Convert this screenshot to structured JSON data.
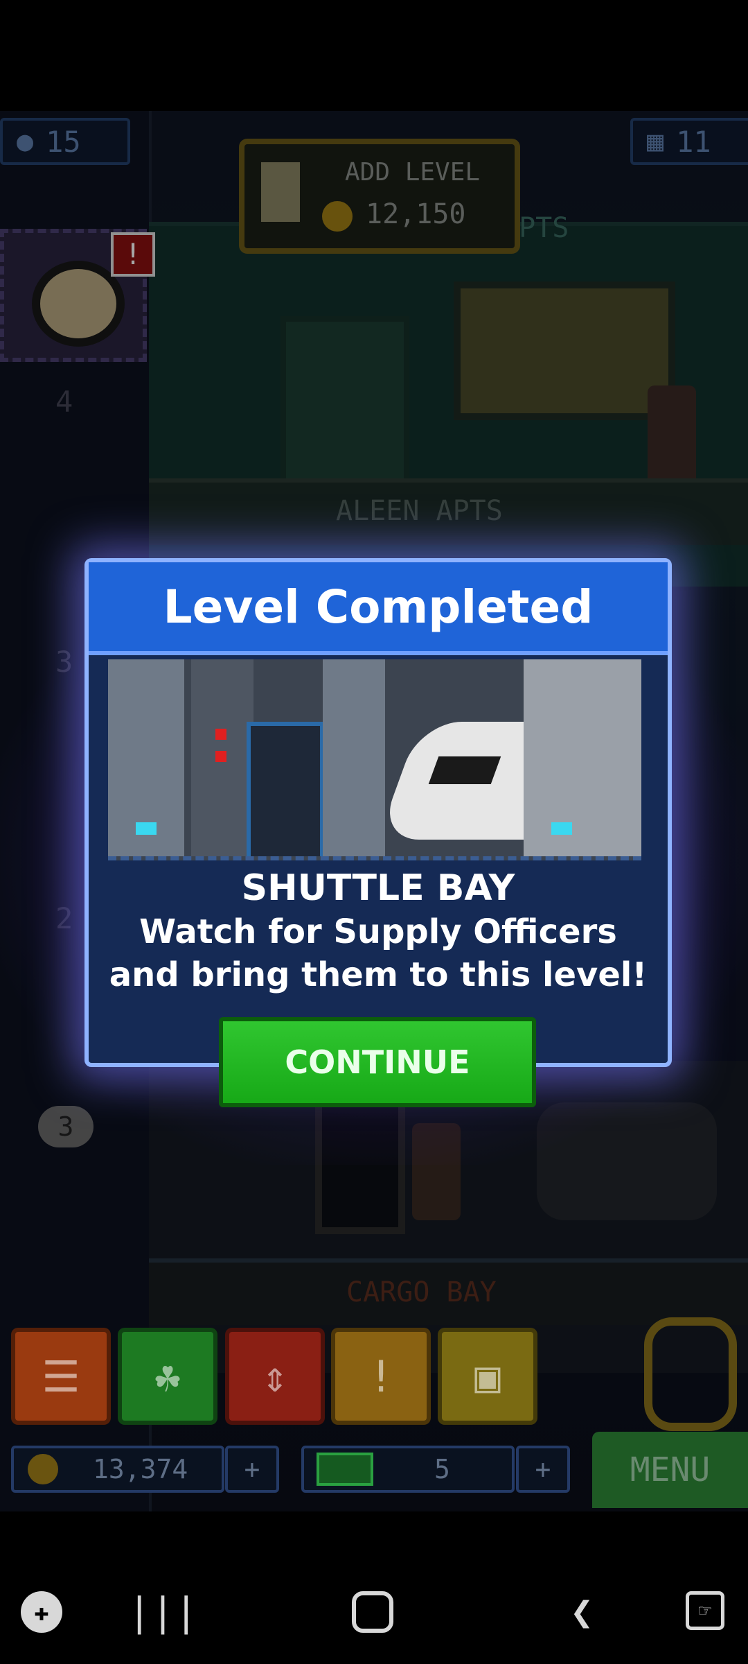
{
  "hud": {
    "residents_count": "15",
    "floors_count": "11",
    "add_level_label": "ADD LEVEL",
    "add_level_cost": "12,150",
    "alert_badge": "!",
    "elevator_floor_4": "4",
    "elevator_floor_3": "3",
    "elevator_floor_2": "2",
    "bubble_number": "3"
  },
  "floors": {
    "upper_sign": "APTS",
    "aleen_sign": "ALEEN APTS",
    "cargo_sign": "CARGO BAY"
  },
  "dialog": {
    "title": "Level Completed",
    "level_name": "SHUTTLE BAY",
    "description_line1": "Watch for Supply Officers",
    "description_line2": "and bring them to this level!",
    "continue_label": "CONTINUE"
  },
  "bottom_bar": {
    "coins": "13,374",
    "bux": "5",
    "plus_label": "+",
    "menu_label": "MENU"
  },
  "icons": {
    "toolbar": [
      "list-icon",
      "alien-icon",
      "elevator-icon",
      "alert-icon",
      "crate-icon"
    ],
    "nav": [
      "game-launcher-icon",
      "recents-icon",
      "home-icon",
      "back-icon",
      "screenshot-icon"
    ]
  },
  "colors": {
    "dialog_title_bg": "#1f64d8",
    "continue_green": "#22b822",
    "dialog_bg": "#152a55"
  }
}
